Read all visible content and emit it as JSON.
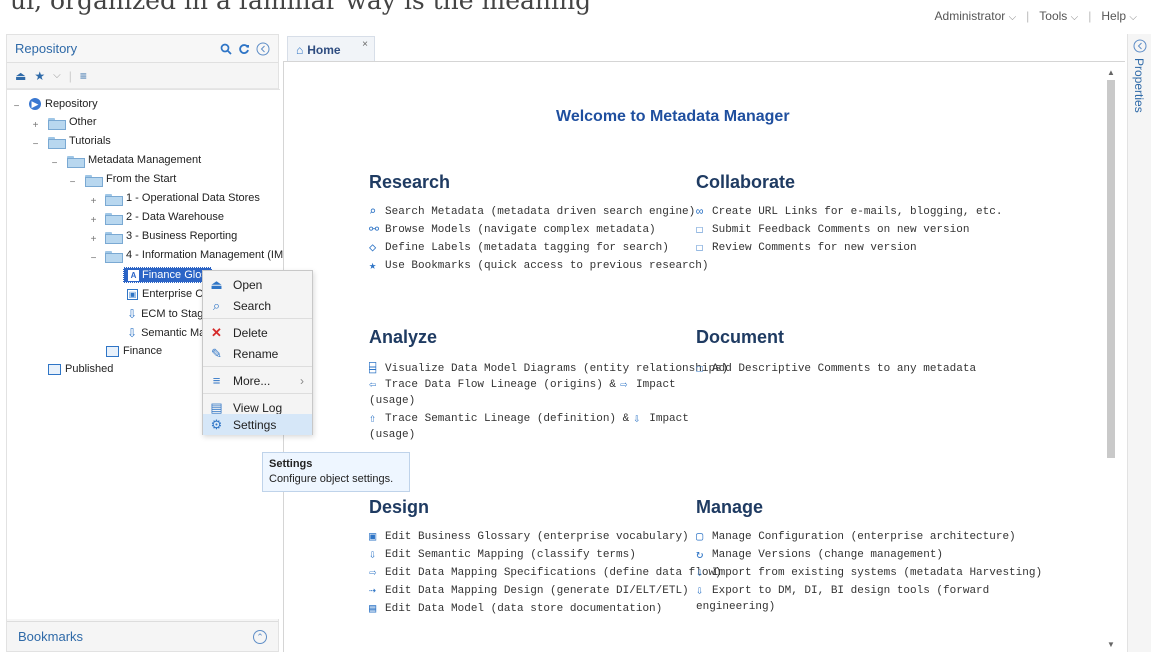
{
  "header": {
    "clip_text": "ui, organized in a familiar way is the meaning",
    "nav": [
      "Administrator",
      "Tools",
      "Help"
    ]
  },
  "left": {
    "title": "Repository",
    "bookmarks": "Bookmarks",
    "tree": [
      {
        "label": "Repository"
      },
      {
        "label": "Other"
      },
      {
        "label": "Tutorials"
      },
      {
        "label": "Metadata Management"
      },
      {
        "label": "From the Start"
      },
      {
        "label": "1 - Operational Data Stores"
      },
      {
        "label": "2 - Data Warehouse"
      },
      {
        "label": "3 - Business Reporting"
      },
      {
        "label": "4 - Information Management (IM"
      },
      {
        "label": "Finance Glos"
      },
      {
        "label": "Enterprise C"
      },
      {
        "label": "ECM to Stag"
      },
      {
        "label": "Semantic Ma"
      },
      {
        "label": "Finance"
      },
      {
        "label": "Published"
      }
    ]
  },
  "tab": {
    "label": "Home"
  },
  "side": {
    "label": "Properties"
  },
  "welcome": "Welcome to Metadata Manager",
  "sections": {
    "research": {
      "title": "Research",
      "items": [
        "Search Metadata (metadata driven search engine)",
        "Browse Models (navigate complex metadata)",
        "Define Labels (metadata tagging for search)",
        "Use Bookmarks (quick access to previous research)"
      ]
    },
    "collaborate": {
      "title": "Collaborate",
      "items": [
        "Create URL Links for e-mails, blogging, etc.",
        "Submit Feedback Comments on new version",
        "Review Comments for new version"
      ]
    },
    "analyze": {
      "title": "Analyze",
      "items": [
        "Visualize Data Model Diagrams (entity relationships)",
        "Trace Data Flow Lineage (origins) &",
        "Impact",
        "(usage)",
        "Trace Semantic Lineage (definition) &",
        "Impact",
        "(usage)"
      ]
    },
    "document": {
      "title": "Document",
      "items": [
        "Add Descriptive Comments to any metadata"
      ]
    },
    "design": {
      "title": "Design",
      "items": [
        "Edit Business Glossary (enterprise vocabulary)",
        "Edit Semantic Mapping (classify terms)",
        "Edit Data Mapping Specifications (define data flow)",
        "Edit Data Mapping Design (generate DI/ELT/ETL)",
        "Edit Data Model (data store documentation)"
      ]
    },
    "manage": {
      "title": "Manage",
      "items": [
        "Manage Configuration (enterprise architecture)",
        "Manage Versions (change management)",
        "Import from existing systems (metadata Harvesting)",
        "Export to DM, DI, BI design tools (forward",
        "engineering)"
      ]
    }
  },
  "context_menu": {
    "items": [
      "Open",
      "Search",
      "Delete",
      "Rename",
      "More...",
      "View Log",
      "Settings"
    ]
  },
  "tooltip": {
    "title": "Settings",
    "text": "Configure object settings."
  }
}
